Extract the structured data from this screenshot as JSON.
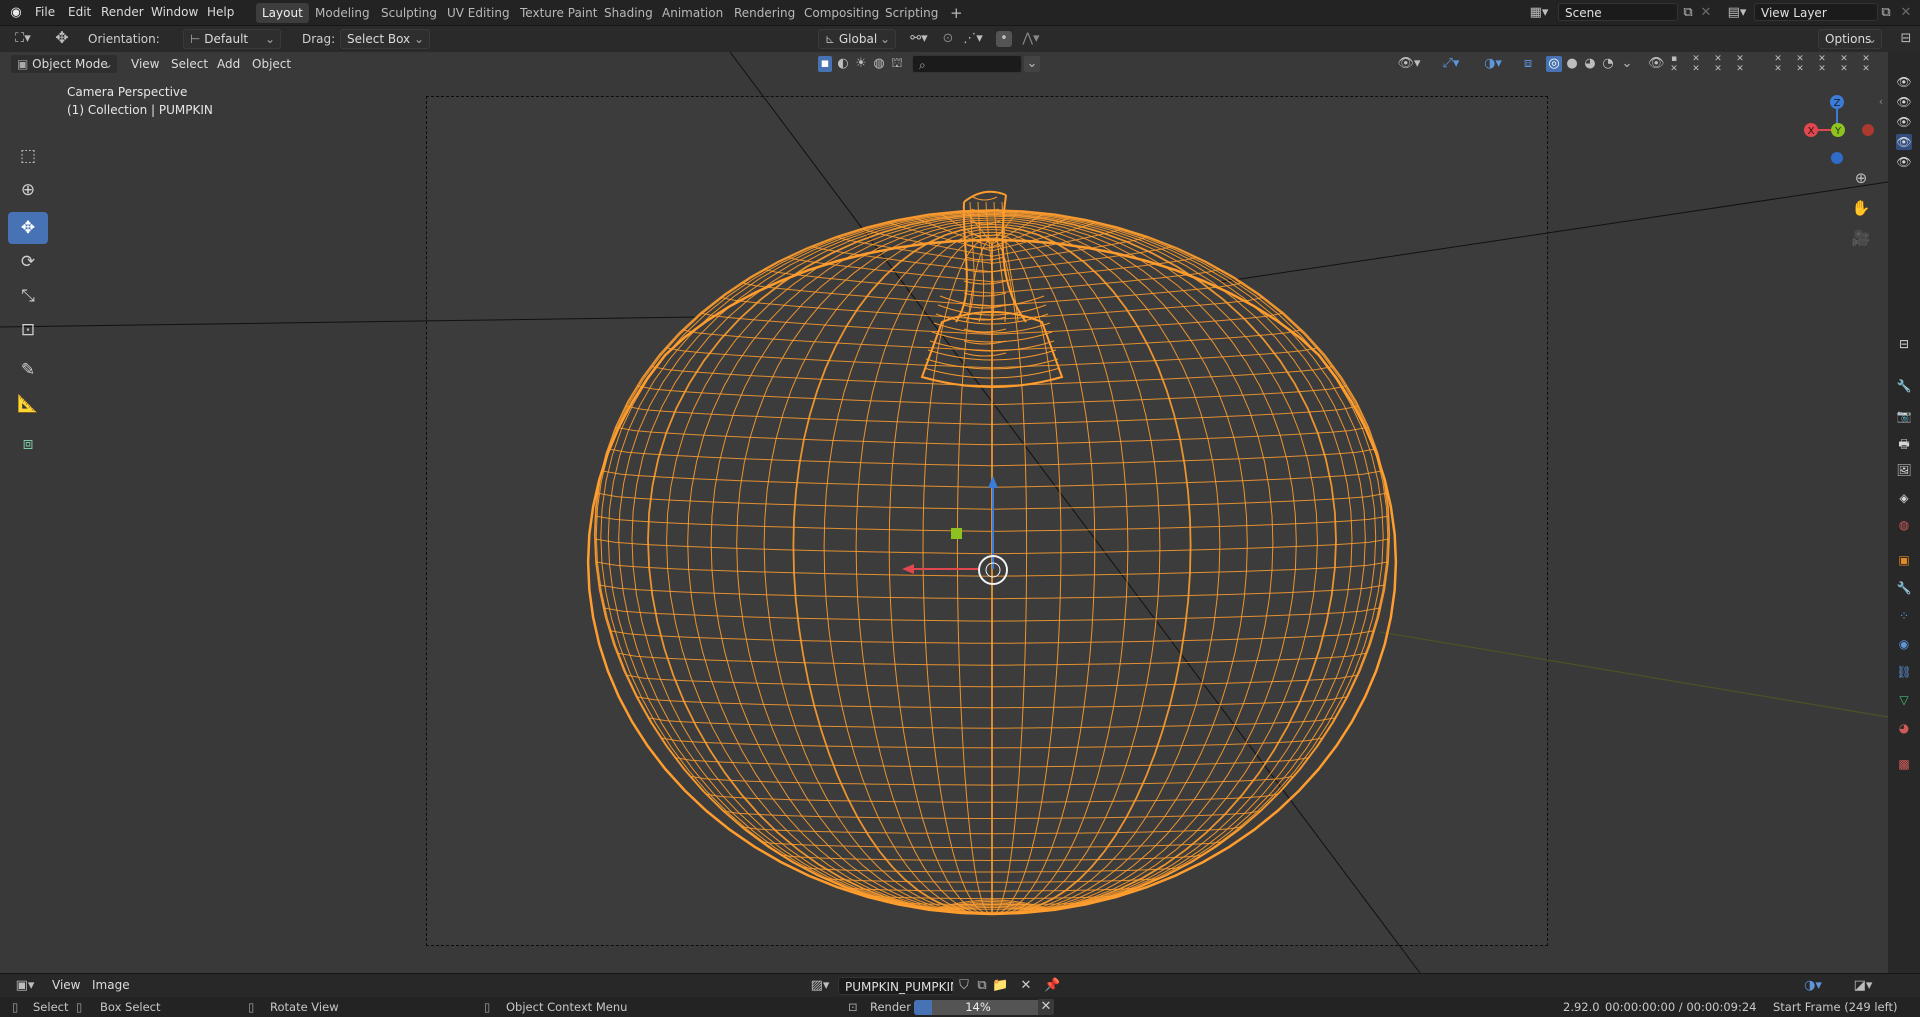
{
  "menubar": {
    "items": [
      "File",
      "Edit",
      "Render",
      "Window",
      "Help"
    ],
    "workspaces": [
      "Layout",
      "Modeling",
      "Sculpting",
      "UV Editing",
      "Texture Paint",
      "Shading",
      "Animation",
      "Rendering",
      "Compositing",
      "Scripting"
    ],
    "active_workspace": "Layout",
    "add_tab": "+",
    "scene": "Scene",
    "view_layer": "View Layer"
  },
  "tool_header": {
    "orientation_label": "Orientation:",
    "orientation_value": "Default",
    "drag_label": "Drag:",
    "drag_value": "Select Box",
    "transform_orientation": "Global",
    "options": "Options"
  },
  "view_header": {
    "mode": "Object Mode",
    "menus": [
      "View",
      "Select",
      "Add",
      "Object"
    ]
  },
  "viewport": {
    "info_line1": "Camera Perspective",
    "info_line2": "(1) Collection | PUMPKIN",
    "gizmo_x": "X",
    "gizmo_y": "Y",
    "gizmo_z": "Z",
    "wire_color": "#ff9d2e",
    "background": "#393939"
  },
  "bottom_header": {
    "menus": [
      "View",
      "Image"
    ],
    "image_name": "PUMPKIN_PUMPKIN..."
  },
  "status_bar": {
    "select": "Select",
    "box_select": "Box Select",
    "rotate_view": "Rotate View",
    "context_menu": "Object Context Menu",
    "render_label": "Render",
    "render_progress_text": "14%",
    "render_progress": 0.14,
    "version": "2.92.0",
    "timecode": "00:00:00:00 / 00:00:09:24",
    "start_frame": "Start Frame (249 left)"
  },
  "colors": {
    "accent": "#4772b3",
    "axis_x": "#e0474f",
    "axis_y": "#8ec21f",
    "axis_z": "#3c7bd8"
  }
}
